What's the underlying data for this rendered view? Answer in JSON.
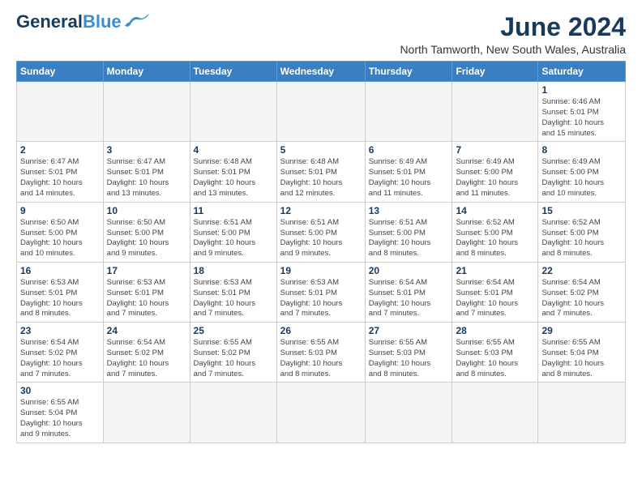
{
  "header": {
    "logo_main": "General",
    "logo_blue": "Blue",
    "month_title": "June 2024",
    "location": "North Tamworth, New South Wales, Australia"
  },
  "weekdays": [
    "Sunday",
    "Monday",
    "Tuesday",
    "Wednesday",
    "Thursday",
    "Friday",
    "Saturday"
  ],
  "weeks": [
    [
      {
        "day": "",
        "info": ""
      },
      {
        "day": "",
        "info": ""
      },
      {
        "day": "",
        "info": ""
      },
      {
        "day": "",
        "info": ""
      },
      {
        "day": "",
        "info": ""
      },
      {
        "day": "",
        "info": ""
      },
      {
        "day": "1",
        "info": "Sunrise: 6:46 AM\nSunset: 5:01 PM\nDaylight: 10 hours\nand 15 minutes."
      }
    ],
    [
      {
        "day": "2",
        "info": "Sunrise: 6:47 AM\nSunset: 5:01 PM\nDaylight: 10 hours\nand 14 minutes."
      },
      {
        "day": "3",
        "info": "Sunrise: 6:47 AM\nSunset: 5:01 PM\nDaylight: 10 hours\nand 13 minutes."
      },
      {
        "day": "4",
        "info": "Sunrise: 6:48 AM\nSunset: 5:01 PM\nDaylight: 10 hours\nand 13 minutes."
      },
      {
        "day": "5",
        "info": "Sunrise: 6:48 AM\nSunset: 5:01 PM\nDaylight: 10 hours\nand 12 minutes."
      },
      {
        "day": "6",
        "info": "Sunrise: 6:49 AM\nSunset: 5:01 PM\nDaylight: 10 hours\nand 11 minutes."
      },
      {
        "day": "7",
        "info": "Sunrise: 6:49 AM\nSunset: 5:00 PM\nDaylight: 10 hours\nand 11 minutes."
      },
      {
        "day": "8",
        "info": "Sunrise: 6:49 AM\nSunset: 5:00 PM\nDaylight: 10 hours\nand 10 minutes."
      }
    ],
    [
      {
        "day": "9",
        "info": "Sunrise: 6:50 AM\nSunset: 5:00 PM\nDaylight: 10 hours\nand 10 minutes."
      },
      {
        "day": "10",
        "info": "Sunrise: 6:50 AM\nSunset: 5:00 PM\nDaylight: 10 hours\nand 9 minutes."
      },
      {
        "day": "11",
        "info": "Sunrise: 6:51 AM\nSunset: 5:00 PM\nDaylight: 10 hours\nand 9 minutes."
      },
      {
        "day": "12",
        "info": "Sunrise: 6:51 AM\nSunset: 5:00 PM\nDaylight: 10 hours\nand 9 minutes."
      },
      {
        "day": "13",
        "info": "Sunrise: 6:51 AM\nSunset: 5:00 PM\nDaylight: 10 hours\nand 8 minutes."
      },
      {
        "day": "14",
        "info": "Sunrise: 6:52 AM\nSunset: 5:00 PM\nDaylight: 10 hours\nand 8 minutes."
      },
      {
        "day": "15",
        "info": "Sunrise: 6:52 AM\nSunset: 5:00 PM\nDaylight: 10 hours\nand 8 minutes."
      }
    ],
    [
      {
        "day": "16",
        "info": "Sunrise: 6:53 AM\nSunset: 5:01 PM\nDaylight: 10 hours\nand 8 minutes."
      },
      {
        "day": "17",
        "info": "Sunrise: 6:53 AM\nSunset: 5:01 PM\nDaylight: 10 hours\nand 7 minutes."
      },
      {
        "day": "18",
        "info": "Sunrise: 6:53 AM\nSunset: 5:01 PM\nDaylight: 10 hours\nand 7 minutes."
      },
      {
        "day": "19",
        "info": "Sunrise: 6:53 AM\nSunset: 5:01 PM\nDaylight: 10 hours\nand 7 minutes."
      },
      {
        "day": "20",
        "info": "Sunrise: 6:54 AM\nSunset: 5:01 PM\nDaylight: 10 hours\nand 7 minutes."
      },
      {
        "day": "21",
        "info": "Sunrise: 6:54 AM\nSunset: 5:01 PM\nDaylight: 10 hours\nand 7 minutes."
      },
      {
        "day": "22",
        "info": "Sunrise: 6:54 AM\nSunset: 5:02 PM\nDaylight: 10 hours\nand 7 minutes."
      }
    ],
    [
      {
        "day": "23",
        "info": "Sunrise: 6:54 AM\nSunset: 5:02 PM\nDaylight: 10 hours\nand 7 minutes."
      },
      {
        "day": "24",
        "info": "Sunrise: 6:54 AM\nSunset: 5:02 PM\nDaylight: 10 hours\nand 7 minutes."
      },
      {
        "day": "25",
        "info": "Sunrise: 6:55 AM\nSunset: 5:02 PM\nDaylight: 10 hours\nand 7 minutes."
      },
      {
        "day": "26",
        "info": "Sunrise: 6:55 AM\nSunset: 5:03 PM\nDaylight: 10 hours\nand 8 minutes."
      },
      {
        "day": "27",
        "info": "Sunrise: 6:55 AM\nSunset: 5:03 PM\nDaylight: 10 hours\nand 8 minutes."
      },
      {
        "day": "28",
        "info": "Sunrise: 6:55 AM\nSunset: 5:03 PM\nDaylight: 10 hours\nand 8 minutes."
      },
      {
        "day": "29",
        "info": "Sunrise: 6:55 AM\nSunset: 5:04 PM\nDaylight: 10 hours\nand 8 minutes."
      }
    ],
    [
      {
        "day": "30",
        "info": "Sunrise: 6:55 AM\nSunset: 5:04 PM\nDaylight: 10 hours\nand 9 minutes."
      },
      {
        "day": "",
        "info": ""
      },
      {
        "day": "",
        "info": ""
      },
      {
        "day": "",
        "info": ""
      },
      {
        "day": "",
        "info": ""
      },
      {
        "day": "",
        "info": ""
      },
      {
        "day": "",
        "info": ""
      }
    ]
  ]
}
